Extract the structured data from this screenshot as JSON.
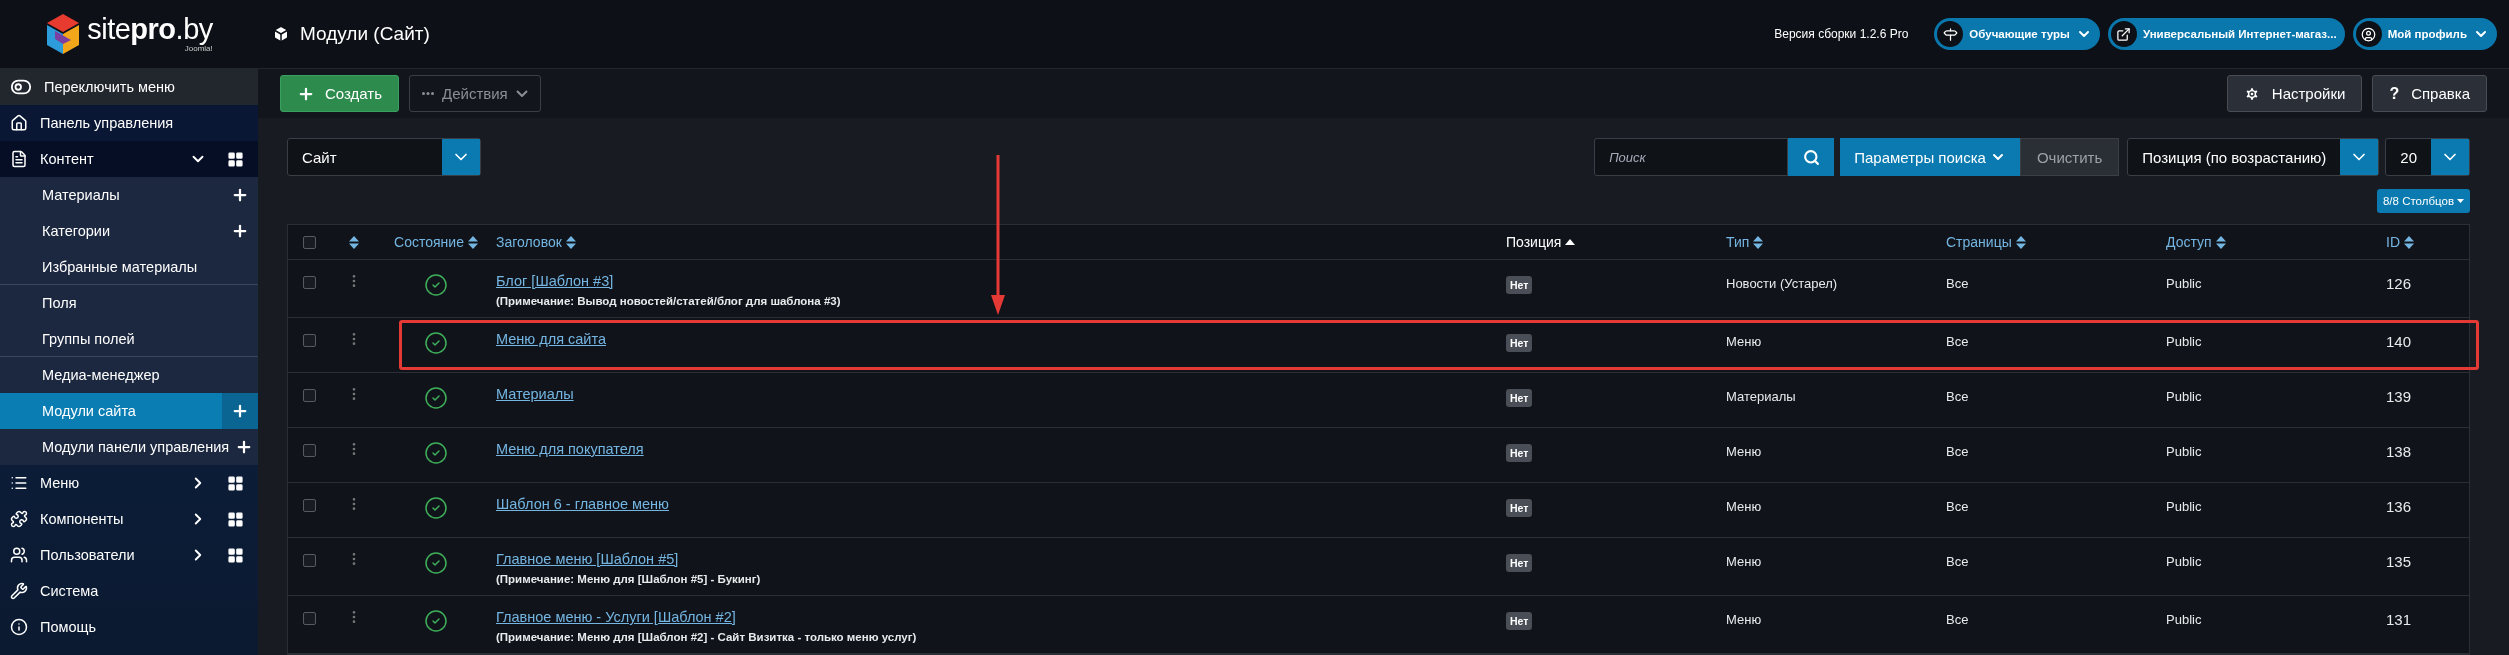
{
  "header": {
    "logo": "site**pro**.by",
    "logo_sub": "Joomla!",
    "title": "Модули (Сайт)",
    "version": "Версия сборки 1.2.6 Pro",
    "pills": [
      {
        "label": "Обучающие туры",
        "dropdown": true
      },
      {
        "label": "Универсальный Интернет-магаз...",
        "dropdown": false
      },
      {
        "label": "Мой профиль",
        "dropdown": true
      }
    ]
  },
  "sidebar": {
    "toggle": "Переключить меню",
    "items": [
      {
        "label": "Панель управления"
      },
      {
        "label": "Контент",
        "expanded": true,
        "children": [
          {
            "label": "Материалы",
            "kind": "addable",
            "selected": false
          },
          {
            "label": "Категории",
            "kind": "addable",
            "selected": false
          },
          {
            "label": "Избранные материалы",
            "kind": "plain",
            "selected": false
          },
          {
            "label": "Поля",
            "kind": "plain",
            "selected": false
          },
          {
            "label": "Группы полей",
            "kind": "plain",
            "selected": false
          },
          {
            "label": "Медиа-менеджер",
            "kind": "plain",
            "selected": false
          },
          {
            "label": "Модули сайта",
            "kind": "addable",
            "selected": true
          },
          {
            "label": "Модули панели управления",
            "kind": "addable",
            "selected": false
          }
        ]
      },
      {
        "label": "Меню",
        "expanded": false
      },
      {
        "label": "Компоненты",
        "expanded": false
      },
      {
        "label": "Пользователи",
        "expanded": false
      },
      {
        "label": "Система"
      },
      {
        "label": "Помощь"
      }
    ]
  },
  "toolbar": {
    "create": "Создать",
    "actions": {
      "label": "Действия",
      "disabled": true
    },
    "options": "Настройки",
    "help": {
      "icon": "?",
      "label": "Справка"
    }
  },
  "filters": {
    "site_select": "Сайт",
    "search": {
      "placeholder": "Поиск"
    },
    "search_options": "Параметры поиска",
    "clear": "Очистить",
    "ordering": "Позиция (по возрастанию)",
    "limit": "20",
    "columns_button": "8/8 Столбцов"
  },
  "table": {
    "select_all_checked": false,
    "columns": [
      {
        "label": "Состояние",
        "sorted": false
      },
      {
        "label": "Заголовок",
        "sorted": false
      },
      {
        "label": "Позиция",
        "sorted": true
      },
      {
        "label": "Тип",
        "sorted": false
      },
      {
        "label": "Страницы",
        "sorted": false
      },
      {
        "label": "Доступ",
        "sorted": false
      },
      {
        "label": "ID",
        "sorted": false
      }
    ],
    "rows": [
      {
        "checked": false,
        "published": true,
        "title": "Блог [Шаблон #3]",
        "note": "(Примечание: Вывод новостей/статей/блог для шаблона #3)",
        "position": "Нет",
        "type": "Новости (Устарел)",
        "pages": "Все",
        "access": "Public",
        "id": "126",
        "highlighted": false
      },
      {
        "checked": false,
        "published": true,
        "title": "Меню для сайта",
        "position": "Нет",
        "type": "Меню",
        "pages": "Все",
        "access": "Public",
        "id": "140",
        "highlighted": true
      },
      {
        "checked": false,
        "published": true,
        "title": "Материалы",
        "position": "Нет",
        "type": "Материалы",
        "pages": "Все",
        "access": "Public",
        "id": "139",
        "highlighted": false
      },
      {
        "checked": false,
        "published": true,
        "title": "Меню для покупателя",
        "position": "Нет",
        "type": "Меню",
        "pages": "Все",
        "access": "Public",
        "id": "138",
        "highlighted": false
      },
      {
        "checked": false,
        "published": true,
        "title": "Шаблон 6 - главное меню",
        "position": "Нет",
        "type": "Меню",
        "pages": "Все",
        "access": "Public",
        "id": "136",
        "highlighted": false
      },
      {
        "checked": false,
        "published": true,
        "title": "Главное меню [Шаблон #5]",
        "note": "(Примечание: Меню для [Шаблон #5] - Букинг)",
        "position": "Нет",
        "type": "Меню",
        "pages": "Все",
        "access": "Public",
        "id": "135",
        "highlighted": false
      },
      {
        "checked": false,
        "published": true,
        "title": "Главное меню - Услуги [Шаблон #2]",
        "note": "(Примечание: Меню для [Шаблон #2] - Сайт Визитка - только меню услуг)",
        "position": "Нет",
        "type": "Меню",
        "pages": "Все",
        "access": "Public",
        "id": "131",
        "highlighted": false
      }
    ]
  }
}
